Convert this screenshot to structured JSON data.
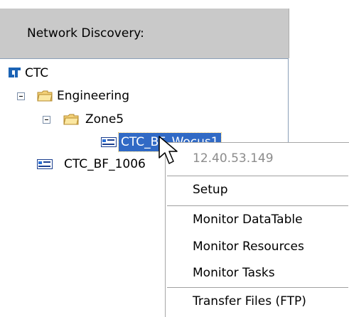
{
  "panel": {
    "header": "Network Discovery:"
  },
  "tree": {
    "root": {
      "label": "CTC",
      "icon": "ctc-logo-icon"
    },
    "engineering": {
      "label": "Engineering",
      "icon": "folder-icon"
    },
    "zone5": {
      "label": "Zone5",
      "icon": "folder-icon"
    },
    "device_selected": {
      "label": "CTC_BF_Wocus1",
      "icon": "device-icon"
    },
    "device2": {
      "label": "CTC_BF_1006",
      "icon": "device-icon"
    }
  },
  "context_menu": {
    "ip": "12.40.53.149",
    "setup": "Setup",
    "monitor_datatable": "Monitor DataTable",
    "monitor_resources": "Monitor Resources",
    "monitor_tasks": "Monitor Tasks",
    "transfer_files": "Transfer Files (FTP)"
  },
  "colors": {
    "selection": "#316ac5",
    "header_bg": "#c9c9c9",
    "disabled_text": "#8c8c8c",
    "logo": "#1b63b5"
  }
}
